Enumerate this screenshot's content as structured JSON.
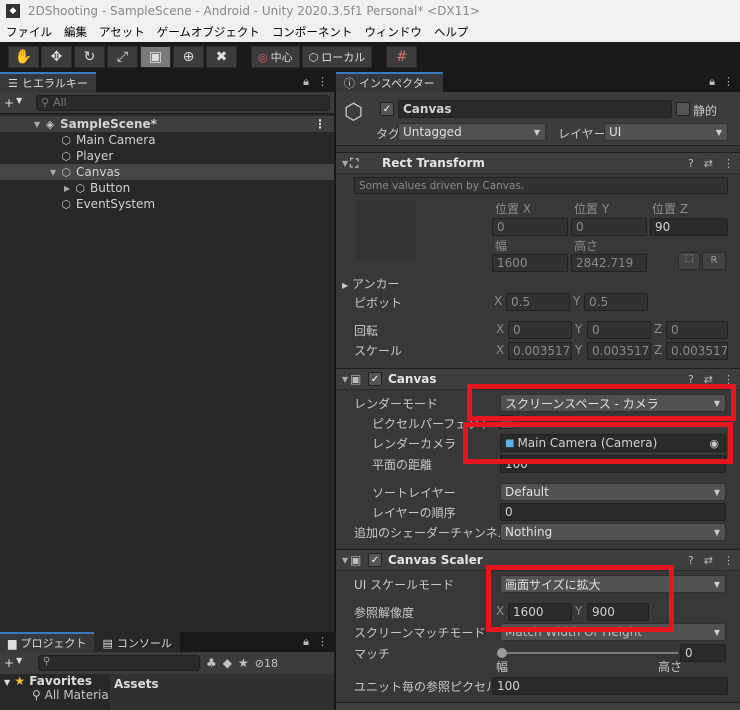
{
  "window": {
    "title": "2DShooting - SampleScene - Android - Unity 2020.3.5f1 Personal* <DX11>"
  },
  "menu": [
    "ファイル",
    "編集",
    "アセット",
    "ゲームオブジェクト",
    "コンポーネント",
    "ウィンドウ",
    "ヘルプ"
  ],
  "toolbar": {
    "pivot_label": "中心",
    "space_label": "ローカル"
  },
  "hierarchy": {
    "tab_label": "ヒエラルキー",
    "search_placeholder": "All",
    "scene": "SampleScene*",
    "items": [
      "Main Camera",
      "Player",
      "Canvas",
      "Button",
      "EventSystem"
    ]
  },
  "project": {
    "tab_project": "プロジェクト",
    "tab_console": "コンソール",
    "badge_count": "18",
    "favorites_label": "Favorites",
    "fav_item": "All Materia",
    "assets_label": "Assets"
  },
  "inspector": {
    "tab_label": "インスペクター",
    "object_name": "Canvas",
    "static_label": "静的",
    "tag_label": "タグ",
    "tag_value": "Untagged",
    "layer_label": "レイヤー",
    "layer_value": "UI",
    "rect_transform": {
      "title": "Rect Transform",
      "note": "Some values driven by Canvas.",
      "pos_x_label": "位置 X",
      "pos_y_label": "位置 Y",
      "pos_z_label": "位置 Z",
      "pos_x": "0",
      "pos_y": "0",
      "pos_z": "90",
      "width_label": "幅",
      "height_label": "高さ",
      "width": "1600",
      "height": "2842.719",
      "r_button": "R",
      "anchor_label": "アンカー",
      "pivot_label": "ピボット",
      "pivot_x": "0.5",
      "pivot_y": "0.5",
      "rotation_label": "回転",
      "rot_x": "0",
      "rot_y": "0",
      "rot_z": "0",
      "scale_label": "スケール",
      "scale_x": "0.0035177",
      "scale_y": "0.0035177",
      "scale_z": "0.0035177"
    },
    "canvas": {
      "title": "Canvas",
      "render_mode_label": "レンダーモード",
      "render_mode": "スクリーンスペース - カメラ",
      "pixel_perfect_label": "ピクセルパーフェクト",
      "render_camera_label": "レンダーカメラ",
      "render_camera": "Main Camera (Camera)",
      "plane_distance_label": "平面の距離",
      "plane_distance": "100",
      "sorting_layer_label": "ソートレイヤー",
      "sorting_layer": "Default",
      "order_label": "レイヤーの順序",
      "order": "0",
      "shader_channels_label": "追加のシェーダーチャンネル",
      "shader_channels": "Nothing"
    },
    "canvas_scaler": {
      "title": "Canvas Scaler",
      "scale_mode_label": "UI スケールモード",
      "scale_mode": "画面サイズに拡大",
      "ref_res_label": "参照解像度",
      "ref_x": "1600",
      "ref_y": "900",
      "match_mode_label": "スクリーンマッチモード",
      "match_mode": "Match Width Or Height",
      "match_label": "マッチ",
      "match_value": "0",
      "match_fraction": 0,
      "width_end": "幅",
      "height_end": "高さ",
      "ppu_label": "ユニット毎の参照ピクセル数",
      "ppu": "100"
    }
  },
  "colors": {
    "highlight_red": "#e5161d",
    "selection": "#3a79bb"
  }
}
